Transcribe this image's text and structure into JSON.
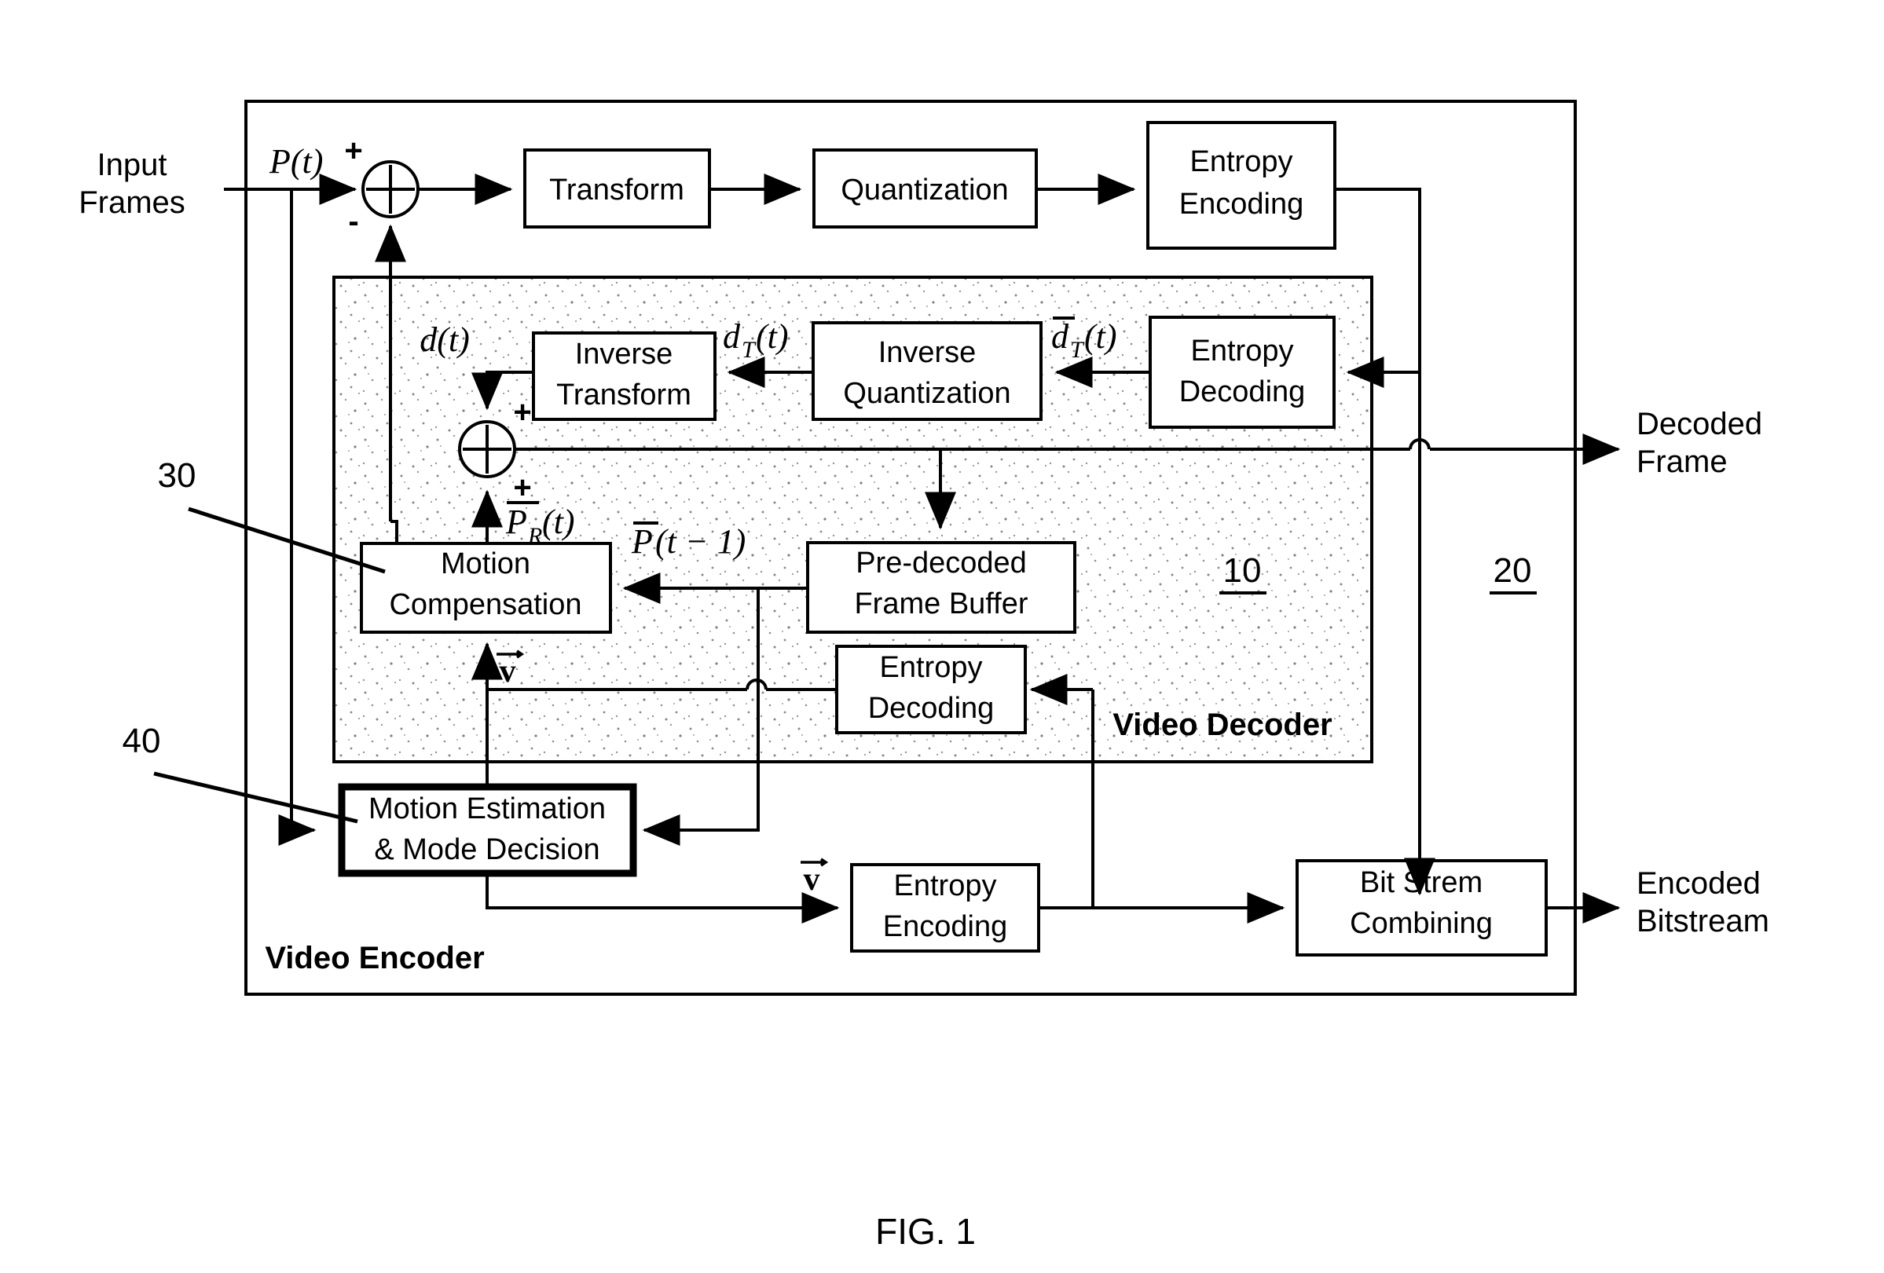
{
  "figure": {
    "caption": "FIG. 1",
    "encoder_label": "Video Encoder",
    "decoder_label": "Video Decoder",
    "ref_decoder": "10",
    "ref_system": "20",
    "ref_motion_comp": "30",
    "ref_motion_est": "40"
  },
  "io": {
    "input_frames_line1": "Input",
    "input_frames_line2": "Frames",
    "decoded_frame_line1": "Decoded",
    "decoded_frame_line2": "Frame",
    "encoded_bitstream_line1": "Encoded",
    "encoded_bitstream_line2": "Bitstream"
  },
  "blocks": {
    "transform": {
      "line1": "Transform",
      "line2": ""
    },
    "quantization": {
      "line1": "Quantization",
      "line2": ""
    },
    "entropy_encoding_top": {
      "line1": "Entropy",
      "line2": "Encoding"
    },
    "inverse_transform": {
      "line1": "Inverse",
      "line2": "Transform"
    },
    "inverse_quantization": {
      "line1": "Inverse",
      "line2": "Quantization"
    },
    "entropy_decoding_top": {
      "line1": "Entropy",
      "line2": "Decoding"
    },
    "motion_compensation": {
      "line1": "Motion",
      "line2": "Compensation"
    },
    "pre_decoded_frame_buffer": {
      "line1": "Pre-decoded",
      "line2": "Frame Buffer"
    },
    "entropy_decoding_mv": {
      "line1": "Entropy",
      "line2": "Decoding"
    },
    "motion_estimation": {
      "line1": "Motion Estimation",
      "line2": "& Mode Decision"
    },
    "entropy_encoding_mv": {
      "line1": "Entropy",
      "line2": "Encoding"
    },
    "bit_stream_combining": {
      "line1": "Bit Strem",
      "line2": "Combining"
    }
  },
  "signals": {
    "p_t": "P(t)",
    "d_t": "d(t)",
    "d_T_t": "d",
    "d_T_t_sub": "T",
    "d_T_t_arg": "(t)",
    "d_T_bar_t": "d",
    "d_T_bar_sub": "T",
    "d_T_bar_arg": "(t)",
    "p_r_bar_t": "P",
    "p_r_bar_sub": "R",
    "p_r_bar_arg": "(t)",
    "p_bar_t_minus_1": "P",
    "p_bar_t_minus_1_arg": "(t − 1)",
    "mv_vector": "v",
    "plus": "+",
    "minus": "-"
  },
  "colors": {
    "ink": "#000000",
    "paper": "#ffffff",
    "stipple": "#7a7a7a"
  }
}
